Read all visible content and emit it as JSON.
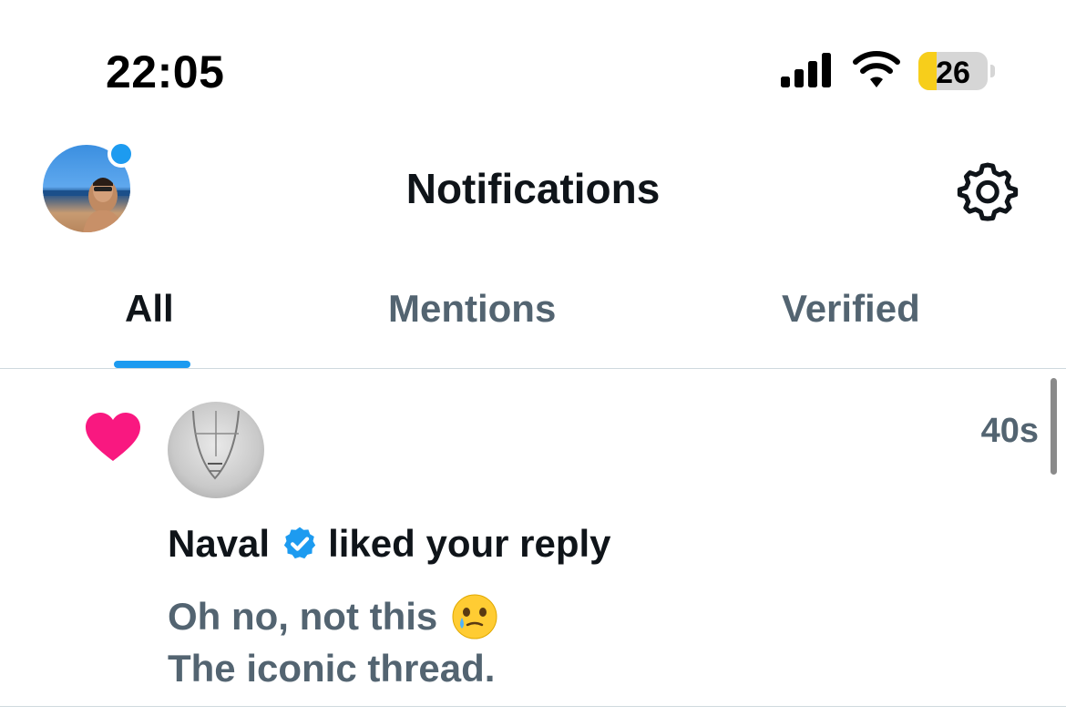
{
  "status_bar": {
    "time": "22:05",
    "battery_level": "26",
    "battery_fraction": 0.26,
    "icons": [
      "cellular-signal-icon",
      "wifi-icon",
      "battery-icon"
    ]
  },
  "header": {
    "title": "Notifications",
    "avatar_icon": "profile-avatar",
    "settings_icon": "gear-icon"
  },
  "tabs": [
    {
      "label": "All",
      "active": true
    },
    {
      "label": "Mentions",
      "active": false
    },
    {
      "label": "Verified",
      "active": false
    }
  ],
  "notification": {
    "icon": "heart-icon",
    "user": "Naval",
    "verified_icon": "verified-badge-icon",
    "action": "liked your reply",
    "time": "40s",
    "tweet_line1": "Oh no, not this",
    "tweet_emoji": "face-holding-back-tears-emoji",
    "tweet_line2": "The iconic thread."
  },
  "colors": {
    "accent": "#1d9bf0",
    "like": "#f91880",
    "text_primary": "#0f1419",
    "text_secondary": "#536471",
    "battery_low": "#f7ce1b"
  }
}
